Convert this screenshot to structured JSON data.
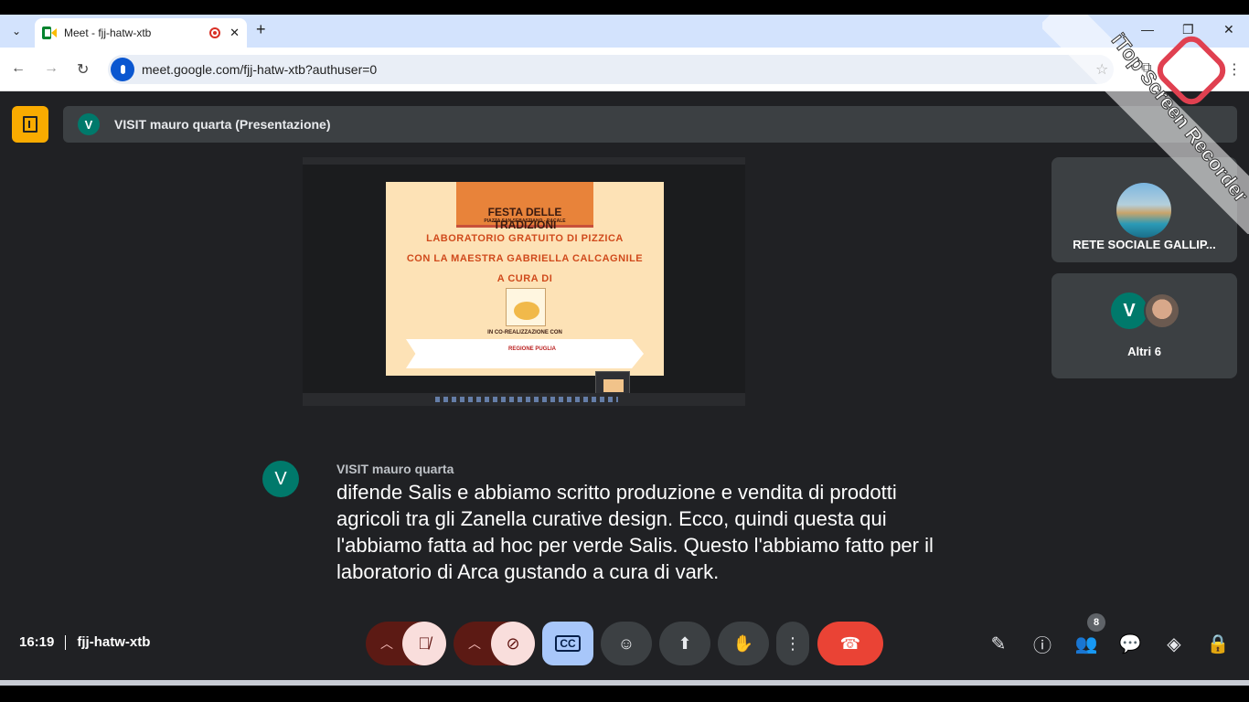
{
  "browser": {
    "tab_title": "Meet - fjj-hatw-xtb",
    "url": "meet.google.com/fjj-hatw-xtb?authuser=0",
    "new_tab_symbol": "+",
    "minimize_symbol": "—",
    "restore_symbol": "❐",
    "close_symbol": "✕"
  },
  "presentation": {
    "presenter_initial": "V",
    "label": "VISIT mauro quarta (Presentazione)",
    "poster_title": "FESTA DELLE TRADIZIONI",
    "poster_subtitle": "PIAZZA SAN SEBASTIANO - RACALE",
    "poster_line1": "LABORATORIO GRATUITO DI PIZZICA",
    "poster_line2": "CON LA MAESTRA  GABRIELLA CALCAGNILE",
    "poster_line3": "A CURA DI",
    "poster_co": "IN CO-REALIZZAZIONE CON",
    "poster_logo_text": "REGIONE PUGLIA"
  },
  "participants": {
    "tile1_name": "RETE SOCIALE GALLIP...",
    "tile2_initial": "V",
    "tile2_name": "Altri 6"
  },
  "caption": {
    "speaker_initial": "V",
    "speaker": "VISIT mauro quarta",
    "lines": [
      "difende Salis e abbiamo scritto produzione e vendita di prodotti",
      "agricoli tra gli Zanella curative design. Ecco, quindi questa qui",
      "l'abbiamo fatta ad hoc per verde Salis. Questo l'abbiamo fatto per il",
      "laboratorio di Arca gustando a cura di vark."
    ]
  },
  "meeting": {
    "time": "16:19",
    "code": "fjj-hatw-xtb",
    "people_count": "8"
  },
  "watermark": {
    "text": "iTop Screen Recorder"
  },
  "colors": {
    "accent_blue": "#0b57d0",
    "end_call_red": "#ea4335",
    "presenter_teal": "#00796b",
    "exit_yellow": "#f9ab00"
  }
}
